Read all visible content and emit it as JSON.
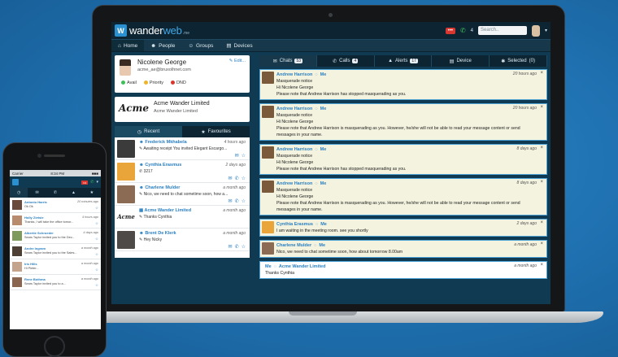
{
  "app": {
    "logo_mark": "W",
    "logo_main": "wander",
    "logo_accent": "web",
    "logo_sub": ".me",
    "top_badge": "•••",
    "top_phone_count": "4",
    "search_placeholder": "Search..",
    "accent_color": "#2a90cf"
  },
  "nav": [
    {
      "icon": "⌂",
      "label": "Home"
    },
    {
      "icon": "☻",
      "label": "People"
    },
    {
      "icon": "☺",
      "label": "Groups"
    },
    {
      "icon": "▤",
      "label": "Devices"
    }
  ],
  "profile": {
    "name": "Nicolene George",
    "email": "acme_ae@bruxolhnet.com",
    "edit_label": "Edit...",
    "statuses": [
      {
        "label": "Avail",
        "color": "#3fbf5c"
      },
      {
        "label": "Priority",
        "color": "#f0b429"
      },
      {
        "label": "DND",
        "color": "#d9362f"
      }
    ]
  },
  "org": {
    "logo": "Acme",
    "name": "Acme Wander Limited",
    "sub": "Acme Wander Limited"
  },
  "left_tabs": [
    {
      "icon": "◷",
      "label": "Recent"
    },
    {
      "icon": "★",
      "label": "Favourites"
    }
  ],
  "recent": [
    {
      "name": "Frederick Mkhabela",
      "time": "4 hours ago",
      "msg": "Awaiting receipt You invited Elegant Escargo...",
      "thumb": "#3b3b3b"
    },
    {
      "name": "Cynthia Erasmus",
      "time": "2 days ago",
      "msg": "3217",
      "thumb": "#e9a43a"
    },
    {
      "name": "Charlene Mulder",
      "time": "a month ago",
      "msg": "Nico, we need to chat sometime soon, how a...",
      "thumb": "#8c6b55"
    },
    {
      "name": "Acme Wander Limited",
      "time": "a month ago",
      "msg": "Thanks Cynthia",
      "thumb": "#ffffff"
    },
    {
      "name": "Brent De Klerk",
      "time": "a month ago",
      "msg": "Hey Nicky",
      "thumb": "#4d4a47"
    }
  ],
  "right_tabs": [
    {
      "icon": "✉",
      "label": "Chats",
      "count": "53"
    },
    {
      "icon": "✆",
      "label": "Calls",
      "count": "4"
    },
    {
      "icon": "▲",
      "label": "Alerts",
      "count": "17"
    },
    {
      "icon": "▤",
      "label": "Device",
      "count": ""
    },
    {
      "icon": "✱",
      "label": "Selected",
      "count": "(0)"
    }
  ],
  "chats": [
    {
      "sender": "Andrew Harrison",
      "to": "Me",
      "time": "20 hours ago",
      "thumb": "#7a5a3a",
      "lines": [
        "Masquerade notice",
        "Hi Nicolene George",
        "Please note that Andrew Harrison has stopped masquerading as you."
      ]
    },
    {
      "sender": "Andrew Harrison",
      "to": "Me",
      "time": "20 hours ago",
      "thumb": "#7a5a3a",
      "lines": [
        "Masquerade notice",
        "Hi Nicolene George",
        "Please note that Andrew Harrison is masquerading as you. However, he/she will not be able to read your message content or send",
        "messages in your name."
      ]
    },
    {
      "sender": "Andrew Harrison",
      "to": "Me",
      "time": "8 days ago",
      "thumb": "#7a5a3a",
      "lines": [
        "Masquerade notice",
        "Hi Nicolene George",
        "Please note that Andrew Harrison has stopped masquerading as you."
      ]
    },
    {
      "sender": "Andrew Harrison",
      "to": "Me",
      "time": "8 days ago",
      "thumb": "#7a5a3a",
      "lines": [
        "Masquerade notice",
        "Hi Nicolene George",
        "Please note that Andrew Harrison is masquerading as you. However, he/she will not be able to read your message content or send",
        "messages in your name."
      ]
    },
    {
      "sender": "Cynthia Erasmus",
      "to": "Me",
      "time": "2 days ago",
      "thumb": "#e9a43a",
      "lines": [
        "I am waiting in the meeting room. see you shortly"
      ]
    },
    {
      "sender": "Charlene Mulder",
      "to": "Me",
      "time": "a month ago",
      "thumb": "#8c6b55",
      "lines": [
        "Nico, we need to chat sometime soon, how about tomorrow 8.00am"
      ]
    },
    {
      "sender": "Me",
      "to": "Acme Wander Limited",
      "time": "a month ago",
      "thumb": "",
      "lines": [
        "Thanks Cynthia"
      ]
    }
  ],
  "phone": {
    "carrier": "Carrier",
    "clock": "8:34 PM",
    "battery": "■■■",
    "badge": "•••",
    "tabs": [
      "◷",
      "✉",
      "✆",
      "▲",
      "★"
    ],
    "items": [
      {
        "name": "Antonio Harris",
        "time": "20 minutes ago",
        "msg": "Ok Ok",
        "thumb": "#6a4a3a"
      },
      {
        "name": "Holly Zietsie",
        "time": "4 hours ago",
        "msg": "Thanks, I will take the office tomor...",
        "thumb": "#b98b6e"
      },
      {
        "name": "Albertie Schroeder",
        "time": "4 days ago",
        "msg": "Sears Taylor invited you to the Dev...",
        "thumb": "#7f9a5d"
      },
      {
        "name": "Andre Ingram",
        "time": "a month ago",
        "msg": "Sears Taylor invited you to the Sales...",
        "thumb": "#4e3f35"
      },
      {
        "name": "Iris Hills",
        "time": "a month ago",
        "msg": "Hi Pieter...",
        "thumb": "#c5a48d"
      },
      {
        "name": "Rene Bothma",
        "time": "a month ago",
        "msg": "Sears Taylor invited you to a...",
        "thumb": "#8a6550"
      }
    ]
  }
}
